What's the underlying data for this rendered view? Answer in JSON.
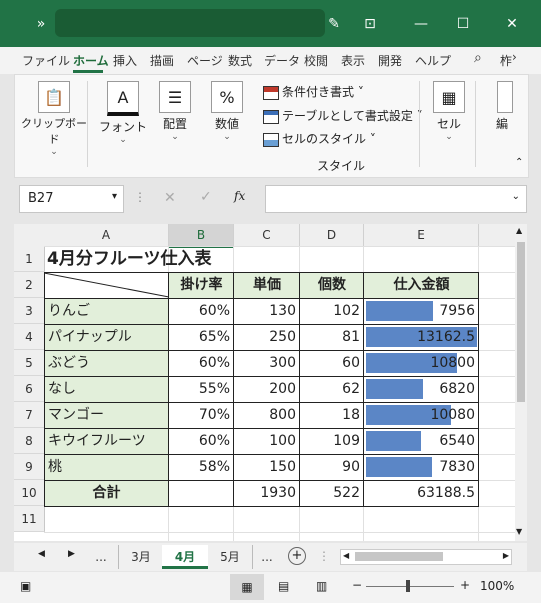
{
  "titlebar": {
    "quick_access": "»",
    "minimize": "—",
    "maximize": "☐",
    "close": "✕"
  },
  "ribbon_tabs": [
    "ファイル",
    "ホーム",
    "挿入",
    "描画",
    "ページ",
    "数式",
    "データ",
    "校閲",
    "表示",
    "開発",
    "ヘルプ"
  ],
  "ribbon_overflow": "柞",
  "groups": {
    "clipboard": "クリップボード",
    "font": "フォント",
    "align": "配置",
    "number": "数値",
    "cells": "セル",
    "editing": "編"
  },
  "styles": {
    "conditional": "条件付き書式 ˅",
    "table": "テーブルとして書式設定 ˅",
    "cell_style": "セルのスタイル ˅",
    "label": "スタイル"
  },
  "formula_bar": {
    "name_box": "B27",
    "cancel": "✕",
    "enter": "✓",
    "fx": "fx",
    "value": ""
  },
  "sheet": {
    "columns": [
      "A",
      "B",
      "C",
      "D",
      "E"
    ],
    "rows": [
      "1",
      "2",
      "3",
      "4",
      "5",
      "6",
      "7",
      "8",
      "9",
      "10",
      "11"
    ],
    "title": "4月分フルーツ仕入表",
    "headers": [
      "掛け率",
      "単価",
      "個数",
      "仕入金額"
    ],
    "items": [
      {
        "name": "りんご",
        "rate": "60%",
        "price": "130",
        "qty": "102",
        "amount": "7956",
        "bar": 0.605
      },
      {
        "name": "パイナップル",
        "rate": "65%",
        "price": "250",
        "qty": "81",
        "amount": "13162.5",
        "bar": 1.0
      },
      {
        "name": "ぶどう",
        "rate": "60%",
        "price": "300",
        "qty": "60",
        "amount": "10800",
        "bar": 0.821
      },
      {
        "name": "なし",
        "rate": "55%",
        "price": "200",
        "qty": "62",
        "amount": "6820",
        "bar": 0.518
      },
      {
        "name": "マンゴー",
        "rate": "70%",
        "price": "800",
        "qty": "18",
        "amount": "10080",
        "bar": 0.766
      },
      {
        "name": "キウイフルーツ",
        "rate": "60%",
        "price": "100",
        "qty": "109",
        "amount": "6540",
        "bar": 0.497
      },
      {
        "name": "桃",
        "rate": "58%",
        "price": "150",
        "qty": "90",
        "amount": "7830",
        "bar": 0.595
      }
    ],
    "total": {
      "label": "合計",
      "rate": "",
      "price": "1930",
      "qty": "522",
      "amount": "63188.5"
    }
  },
  "sheet_tabs": [
    "...",
    "3月",
    "4月",
    "5月",
    "..."
  ],
  "active_sheet": "4月",
  "status": {
    "zoom": "100%",
    "minus": "−",
    "plus": "+"
  },
  "colors": {
    "accent": "#217346",
    "header_fill": "#e2efda",
    "databar": "#5b86c6"
  }
}
